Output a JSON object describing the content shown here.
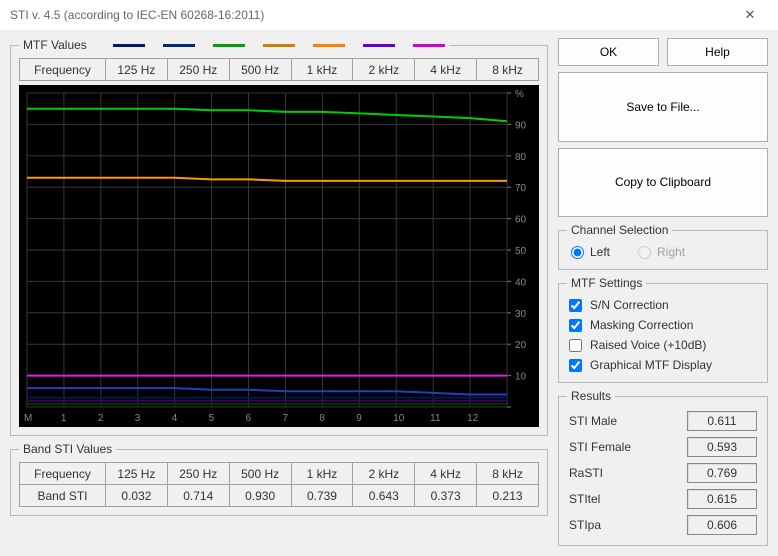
{
  "window": {
    "title": "STI v. 4.5 (according to IEC-EN 60268-16:2011)",
    "close_glyph": "✕"
  },
  "legend": {
    "title": "MTF Values",
    "colors": [
      "#001a66",
      "#002a7a",
      "#00a000",
      "#d08000",
      "#ff8000",
      "#6600cc",
      "#d000d0"
    ]
  },
  "freq_header": {
    "label": "Frequency",
    "bands": [
      "125 Hz",
      "250 Hz",
      "500 Hz",
      "1 kHz",
      "2 kHz",
      "4 kHz",
      "8 kHz"
    ]
  },
  "band_sti": {
    "group": "Band STI Values",
    "label": "Frequency",
    "bands": [
      "125 Hz",
      "250 Hz",
      "500 Hz",
      "1 kHz",
      "2 kHz",
      "4 kHz",
      "8 kHz"
    ],
    "row_label": "Band STI",
    "values": [
      "0.032",
      "0.714",
      "0.930",
      "0.739",
      "0.643",
      "0.373",
      "0.213"
    ]
  },
  "buttons": {
    "ok": "OK",
    "help": "Help",
    "save": "Save to File...",
    "copy": "Copy to Clipboard"
  },
  "channel": {
    "group": "Channel Selection",
    "left": "Left",
    "right": "Right",
    "selected": "left",
    "right_enabled": false
  },
  "mtf_settings": {
    "group": "MTF Settings",
    "items": [
      {
        "label": "S/N Correction",
        "checked": true
      },
      {
        "label": "Masking Correction",
        "checked": true
      },
      {
        "label": "Raised Voice (+10dB)",
        "checked": false
      },
      {
        "label": "Graphical MTF Display",
        "checked": true
      }
    ]
  },
  "results": {
    "group": "Results",
    "rows": [
      {
        "label": "STI Male",
        "value": "0.611"
      },
      {
        "label": "STI Female",
        "value": "0.593"
      },
      {
        "label": "RaSTI",
        "value": "0.769"
      },
      {
        "label": "STItel",
        "value": "0.615"
      },
      {
        "label": "STIpa",
        "value": "0.606"
      }
    ]
  },
  "chart_data": {
    "type": "line",
    "x_ticks": [
      "M",
      "1",
      "2",
      "3",
      "4",
      "5",
      "6",
      "7",
      "8",
      "9",
      "10",
      "11",
      "12",
      ""
    ],
    "y_ticks": [
      "%",
      "90",
      "80",
      "70",
      "60",
      "50",
      "40",
      "30",
      "20",
      "10",
      ""
    ],
    "ylim": [
      0,
      100
    ],
    "y_unit": "%",
    "series": [
      {
        "name": "green",
        "color": "#00d000",
        "y": [
          95,
          95,
          95,
          95,
          95,
          94.5,
          94.5,
          94,
          94,
          93.5,
          93,
          92.5,
          92,
          91
        ]
      },
      {
        "name": "orange",
        "color": "#ff9900",
        "y": [
          73,
          73,
          73,
          73,
          73,
          72.5,
          72.5,
          72,
          72,
          72,
          72,
          72,
          72,
          72
        ]
      },
      {
        "name": "magenta",
        "color": "#e020e0",
        "y": [
          10,
          10,
          10,
          10,
          10,
          10,
          10,
          10,
          10,
          10,
          10,
          10,
          10,
          10
        ]
      },
      {
        "name": "blue",
        "color": "#2040c0",
        "y": [
          6,
          6,
          6,
          6,
          6,
          5.5,
          5.5,
          5,
          5,
          5,
          5,
          4.5,
          4,
          4
        ]
      },
      {
        "name": "dark1",
        "color": "#001a4d",
        "y": [
          3,
          3,
          3,
          3,
          3,
          3,
          3,
          3,
          3,
          3,
          3,
          3,
          3,
          3
        ]
      },
      {
        "name": "dark2",
        "color": "#3a0060",
        "y": [
          2,
          2,
          2,
          2,
          2,
          2,
          2,
          2,
          2,
          2,
          2,
          2,
          2,
          2
        ]
      },
      {
        "name": "dark3",
        "color": "#003300",
        "y": [
          1,
          1,
          1,
          1,
          1,
          1,
          1,
          1,
          1,
          1,
          1,
          1,
          1,
          1
        ]
      }
    ]
  }
}
